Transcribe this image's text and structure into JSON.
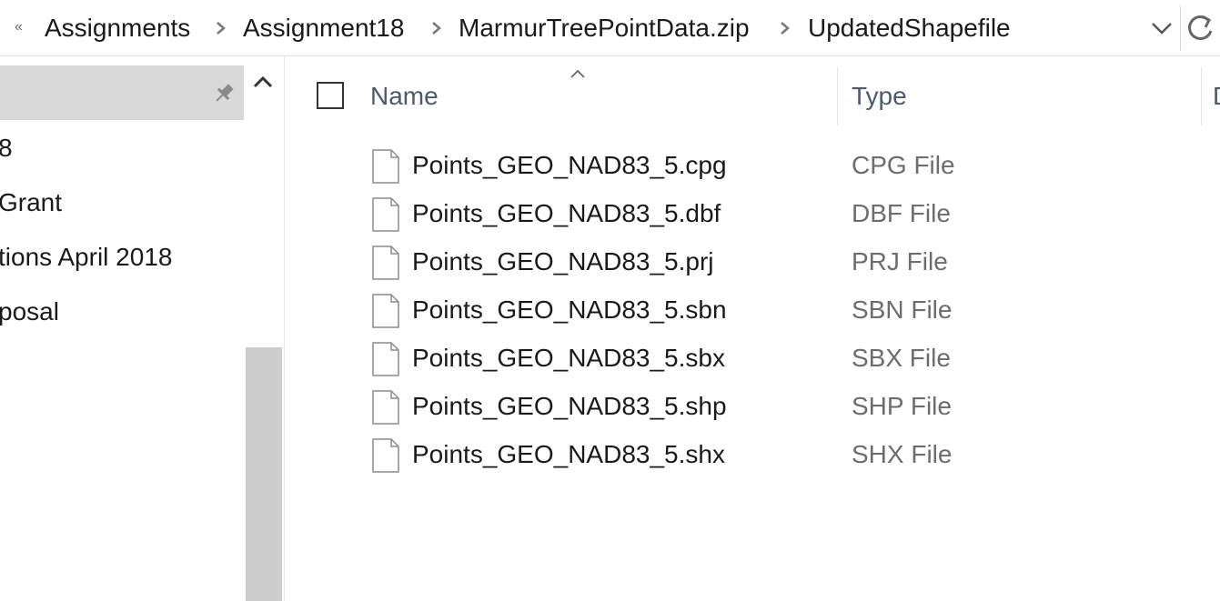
{
  "address_bar": {
    "overflow_glyph": "«",
    "crumbs": [
      "Assignments",
      "Assignment18",
      "MarmurTreePointData.zip",
      "UpdatedShapefile"
    ],
    "dropdown_icon": "chevron-down-icon",
    "refresh_icon": "refresh-icon"
  },
  "nav_pane": {
    "pin_icon": "pin-icon",
    "items": [
      "8",
      " Grant",
      "tions April 2018",
      "posal"
    ]
  },
  "file_list": {
    "columns": {
      "name": "Name",
      "type": "Type",
      "partial": "D"
    },
    "files": [
      {
        "name": "Points_GEO_NAD83_5.cpg",
        "type": "CPG File"
      },
      {
        "name": "Points_GEO_NAD83_5.dbf",
        "type": "DBF File"
      },
      {
        "name": "Points_GEO_NAD83_5.prj",
        "type": "PRJ File"
      },
      {
        "name": "Points_GEO_NAD83_5.sbn",
        "type": "SBN File"
      },
      {
        "name": "Points_GEO_NAD83_5.sbx",
        "type": "SBX File"
      },
      {
        "name": "Points_GEO_NAD83_5.shp",
        "type": "SHP File"
      },
      {
        "name": "Points_GEO_NAD83_5.shx",
        "type": "SHX File"
      }
    ]
  },
  "colors": {
    "nav_selected_bg": "#d9d9d9",
    "header_text": "#4a5a70",
    "type_text": "#6d6d6d",
    "scroll_thumb": "#cdcdcd"
  }
}
